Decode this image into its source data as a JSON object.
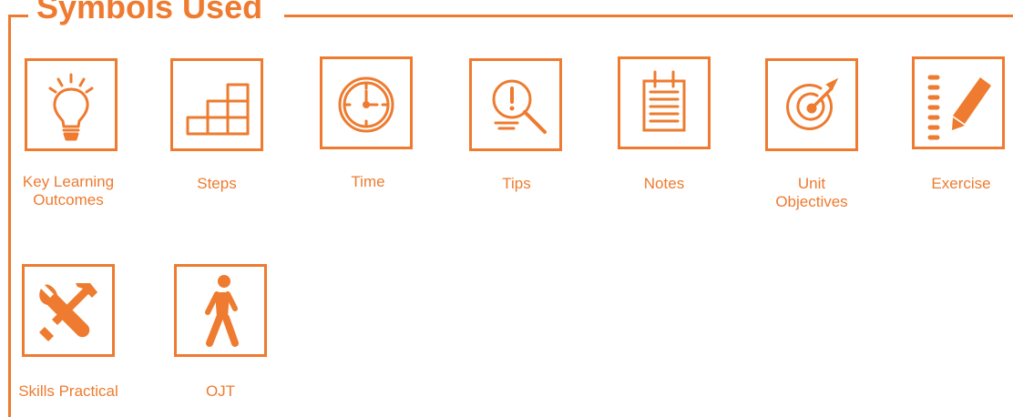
{
  "title": "Symbols Used",
  "accent_color": "#ee7b2f",
  "symbols": [
    {
      "label": "Key Learning\nOutcomes",
      "icon": "lightbulb-icon"
    },
    {
      "label": "Steps",
      "icon": "steps-icon"
    },
    {
      "label": "Time",
      "icon": "clock-icon"
    },
    {
      "label": "Tips",
      "icon": "magnifier-exclamation-icon"
    },
    {
      "label": "Notes",
      "icon": "notepad-icon"
    },
    {
      "label": "Unit\nObjectives",
      "icon": "target-icon"
    },
    {
      "label": "Exercise",
      "icon": "notebook-pencil-icon"
    },
    {
      "label": "Skills Practical",
      "icon": "wrench-hammer-icon"
    },
    {
      "label": "OJT",
      "icon": "walking-person-icon"
    }
  ]
}
